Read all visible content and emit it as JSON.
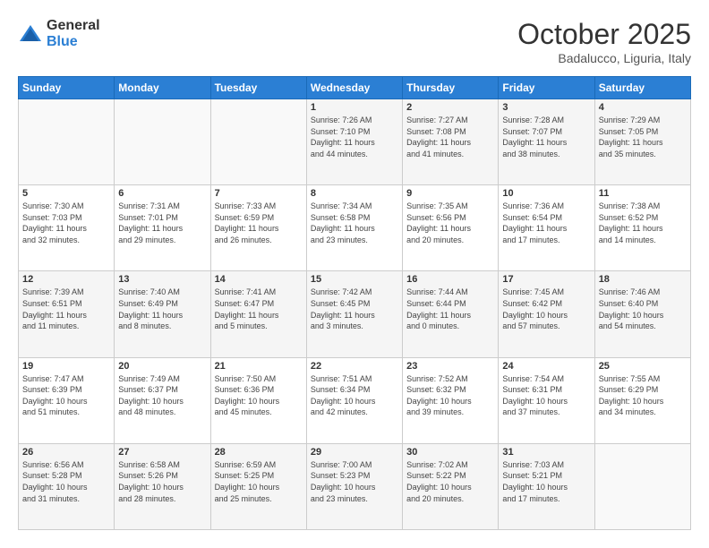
{
  "logo": {
    "general": "General",
    "blue": "Blue"
  },
  "header": {
    "month": "October 2025",
    "location": "Badalucco, Liguria, Italy"
  },
  "days_of_week": [
    "Sunday",
    "Monday",
    "Tuesday",
    "Wednesday",
    "Thursday",
    "Friday",
    "Saturday"
  ],
  "weeks": [
    [
      {
        "day": "",
        "info": ""
      },
      {
        "day": "",
        "info": ""
      },
      {
        "day": "",
        "info": ""
      },
      {
        "day": "1",
        "info": "Sunrise: 7:26 AM\nSunset: 7:10 PM\nDaylight: 11 hours\nand 44 minutes."
      },
      {
        "day": "2",
        "info": "Sunrise: 7:27 AM\nSunset: 7:08 PM\nDaylight: 11 hours\nand 41 minutes."
      },
      {
        "day": "3",
        "info": "Sunrise: 7:28 AM\nSunset: 7:07 PM\nDaylight: 11 hours\nand 38 minutes."
      },
      {
        "day": "4",
        "info": "Sunrise: 7:29 AM\nSunset: 7:05 PM\nDaylight: 11 hours\nand 35 minutes."
      }
    ],
    [
      {
        "day": "5",
        "info": "Sunrise: 7:30 AM\nSunset: 7:03 PM\nDaylight: 11 hours\nand 32 minutes."
      },
      {
        "day": "6",
        "info": "Sunrise: 7:31 AM\nSunset: 7:01 PM\nDaylight: 11 hours\nand 29 minutes."
      },
      {
        "day": "7",
        "info": "Sunrise: 7:33 AM\nSunset: 6:59 PM\nDaylight: 11 hours\nand 26 minutes."
      },
      {
        "day": "8",
        "info": "Sunrise: 7:34 AM\nSunset: 6:58 PM\nDaylight: 11 hours\nand 23 minutes."
      },
      {
        "day": "9",
        "info": "Sunrise: 7:35 AM\nSunset: 6:56 PM\nDaylight: 11 hours\nand 20 minutes."
      },
      {
        "day": "10",
        "info": "Sunrise: 7:36 AM\nSunset: 6:54 PM\nDaylight: 11 hours\nand 17 minutes."
      },
      {
        "day": "11",
        "info": "Sunrise: 7:38 AM\nSunset: 6:52 PM\nDaylight: 11 hours\nand 14 minutes."
      }
    ],
    [
      {
        "day": "12",
        "info": "Sunrise: 7:39 AM\nSunset: 6:51 PM\nDaylight: 11 hours\nand 11 minutes."
      },
      {
        "day": "13",
        "info": "Sunrise: 7:40 AM\nSunset: 6:49 PM\nDaylight: 11 hours\nand 8 minutes."
      },
      {
        "day": "14",
        "info": "Sunrise: 7:41 AM\nSunset: 6:47 PM\nDaylight: 11 hours\nand 5 minutes."
      },
      {
        "day": "15",
        "info": "Sunrise: 7:42 AM\nSunset: 6:45 PM\nDaylight: 11 hours\nand 3 minutes."
      },
      {
        "day": "16",
        "info": "Sunrise: 7:44 AM\nSunset: 6:44 PM\nDaylight: 11 hours\nand 0 minutes."
      },
      {
        "day": "17",
        "info": "Sunrise: 7:45 AM\nSunset: 6:42 PM\nDaylight: 10 hours\nand 57 minutes."
      },
      {
        "day": "18",
        "info": "Sunrise: 7:46 AM\nSunset: 6:40 PM\nDaylight: 10 hours\nand 54 minutes."
      }
    ],
    [
      {
        "day": "19",
        "info": "Sunrise: 7:47 AM\nSunset: 6:39 PM\nDaylight: 10 hours\nand 51 minutes."
      },
      {
        "day": "20",
        "info": "Sunrise: 7:49 AM\nSunset: 6:37 PM\nDaylight: 10 hours\nand 48 minutes."
      },
      {
        "day": "21",
        "info": "Sunrise: 7:50 AM\nSunset: 6:36 PM\nDaylight: 10 hours\nand 45 minutes."
      },
      {
        "day": "22",
        "info": "Sunrise: 7:51 AM\nSunset: 6:34 PM\nDaylight: 10 hours\nand 42 minutes."
      },
      {
        "day": "23",
        "info": "Sunrise: 7:52 AM\nSunset: 6:32 PM\nDaylight: 10 hours\nand 39 minutes."
      },
      {
        "day": "24",
        "info": "Sunrise: 7:54 AM\nSunset: 6:31 PM\nDaylight: 10 hours\nand 37 minutes."
      },
      {
        "day": "25",
        "info": "Sunrise: 7:55 AM\nSunset: 6:29 PM\nDaylight: 10 hours\nand 34 minutes."
      }
    ],
    [
      {
        "day": "26",
        "info": "Sunrise: 6:56 AM\nSunset: 5:28 PM\nDaylight: 10 hours\nand 31 minutes."
      },
      {
        "day": "27",
        "info": "Sunrise: 6:58 AM\nSunset: 5:26 PM\nDaylight: 10 hours\nand 28 minutes."
      },
      {
        "day": "28",
        "info": "Sunrise: 6:59 AM\nSunset: 5:25 PM\nDaylight: 10 hours\nand 25 minutes."
      },
      {
        "day": "29",
        "info": "Sunrise: 7:00 AM\nSunset: 5:23 PM\nDaylight: 10 hours\nand 23 minutes."
      },
      {
        "day": "30",
        "info": "Sunrise: 7:02 AM\nSunset: 5:22 PM\nDaylight: 10 hours\nand 20 minutes."
      },
      {
        "day": "31",
        "info": "Sunrise: 7:03 AM\nSunset: 5:21 PM\nDaylight: 10 hours\nand 17 minutes."
      },
      {
        "day": "",
        "info": ""
      }
    ]
  ]
}
